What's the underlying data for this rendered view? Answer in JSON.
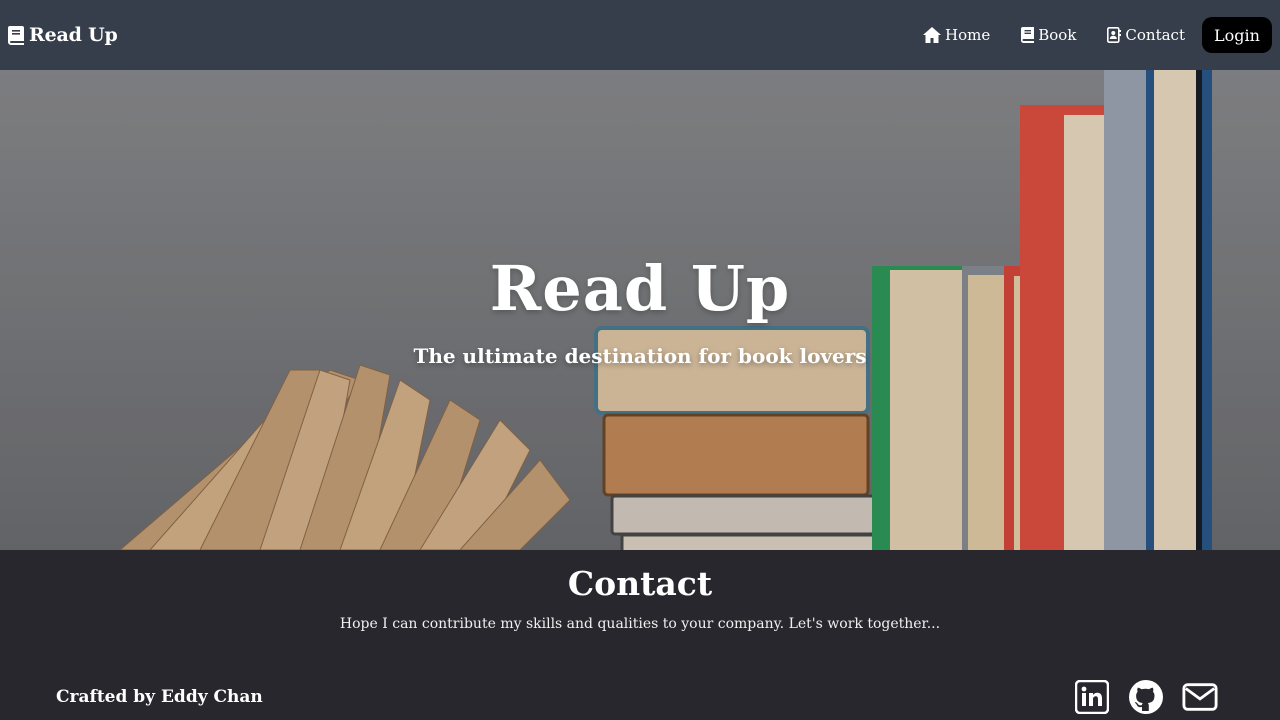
{
  "brand": {
    "name": "Read Up",
    "icon": "book-icon"
  },
  "nav": {
    "items": [
      {
        "label": "Home",
        "icon": "home-icon"
      },
      {
        "label": "Book",
        "icon": "book-icon"
      },
      {
        "label": "Contact",
        "icon": "contact-card-icon"
      }
    ],
    "login_label": "Login"
  },
  "hero": {
    "title": "Read Up",
    "subtitle": "The ultimate destination for book lovers"
  },
  "contact": {
    "title": "Contact",
    "text": "Hope I can contribute my skills and qualities to your company. Let's work together..."
  },
  "footer": {
    "credit": "Crafted by Eddy Chan",
    "social": [
      "linkedin-icon",
      "github-icon",
      "mail-icon"
    ]
  },
  "colors": {
    "navbar_bg": "#363e4b",
    "footer_bg": "#28272d",
    "login_bg": "#000000",
    "text": "#ffffff"
  }
}
